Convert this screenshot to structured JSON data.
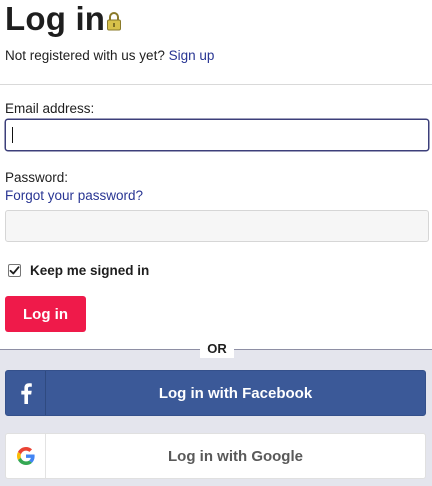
{
  "title": "Log in",
  "register": {
    "prompt": "Not registered with us yet?",
    "link": "Sign up"
  },
  "email": {
    "label": "Email address:",
    "value": ""
  },
  "password": {
    "label": "Password:",
    "forgot_link": "Forgot your password?",
    "value": ""
  },
  "keep_signed_in": {
    "label": "Keep me signed in",
    "checked": true
  },
  "login_button": "Log in",
  "divider": "OR",
  "social": {
    "facebook": {
      "label": "Log in with Facebook",
      "icon": "facebook-icon"
    },
    "google": {
      "label": "Log in with Google",
      "icon": "google-icon"
    }
  },
  "colors": {
    "link": "#283593",
    "login_button": "#ef1a4a",
    "facebook": "#3b5998",
    "bottom_panel": "#e4e5ed"
  }
}
